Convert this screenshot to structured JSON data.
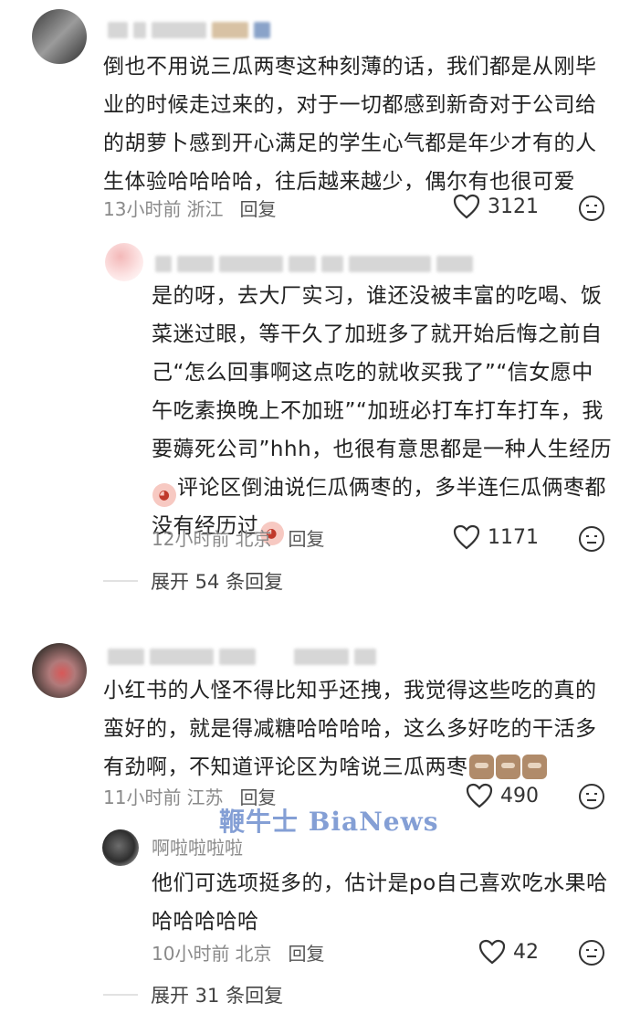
{
  "comments": [
    {
      "text": "倒也不用说三瓜两枣这种刻薄的话，我们都是从刚毕业的时候走过来的，对于一切都感到新奇对于公司给的胡萝卜感到开心满足的学生心气都是年少才有的人生体验哈哈哈哈，往后越来越少，偶尔有也很可爱",
      "time": "13小时前",
      "location": "浙江",
      "reply_label": "回复",
      "likes": "3121",
      "reply": {
        "text_a": "是的呀，去大厂实习，谁还没被丰富的吃喝、饭菜迷过眼，等干久了加班多了就开始后悔之前自己“怎么回事啊这点吃的就收买我了”“信女愿中午吃素换晚上不加班”“加班必打车打车打车，我要薅死公司”hhh，也很有意思都是一种人生经历",
        "text_b": "评论区倒油说仨瓜俩枣的，多半连仨瓜俩枣都没有经历过",
        "time": "12小时前",
        "location": "北京",
        "reply_label": "回复",
        "likes": "1171"
      },
      "expand_label": "展开 54 条回复"
    },
    {
      "text": "小红书的人怪不得比知乎还拽，我觉得这些吃的真的蛮好的，就是得减糖哈哈哈哈，这么多好吃的干活多有劲啊，不知道评论区为啥说三瓜两枣",
      "time": "11小时前",
      "location": "江苏",
      "reply_label": "回复",
      "likes": "490",
      "reply": {
        "username": "啊啦啦啦啦",
        "text": "他们可选项挺多的，估计是po自己喜欢吃水果哈哈哈哈哈哈",
        "time": "10小时前",
        "location": "北京",
        "reply_label": "回复",
        "likes": "42"
      },
      "expand_label": "展开 31 条回复"
    }
  ],
  "watermark": "鞭牛士 BiaNews",
  "icons": {
    "heart": "heart-icon",
    "emoji_react": "emoji-react-icon"
  }
}
